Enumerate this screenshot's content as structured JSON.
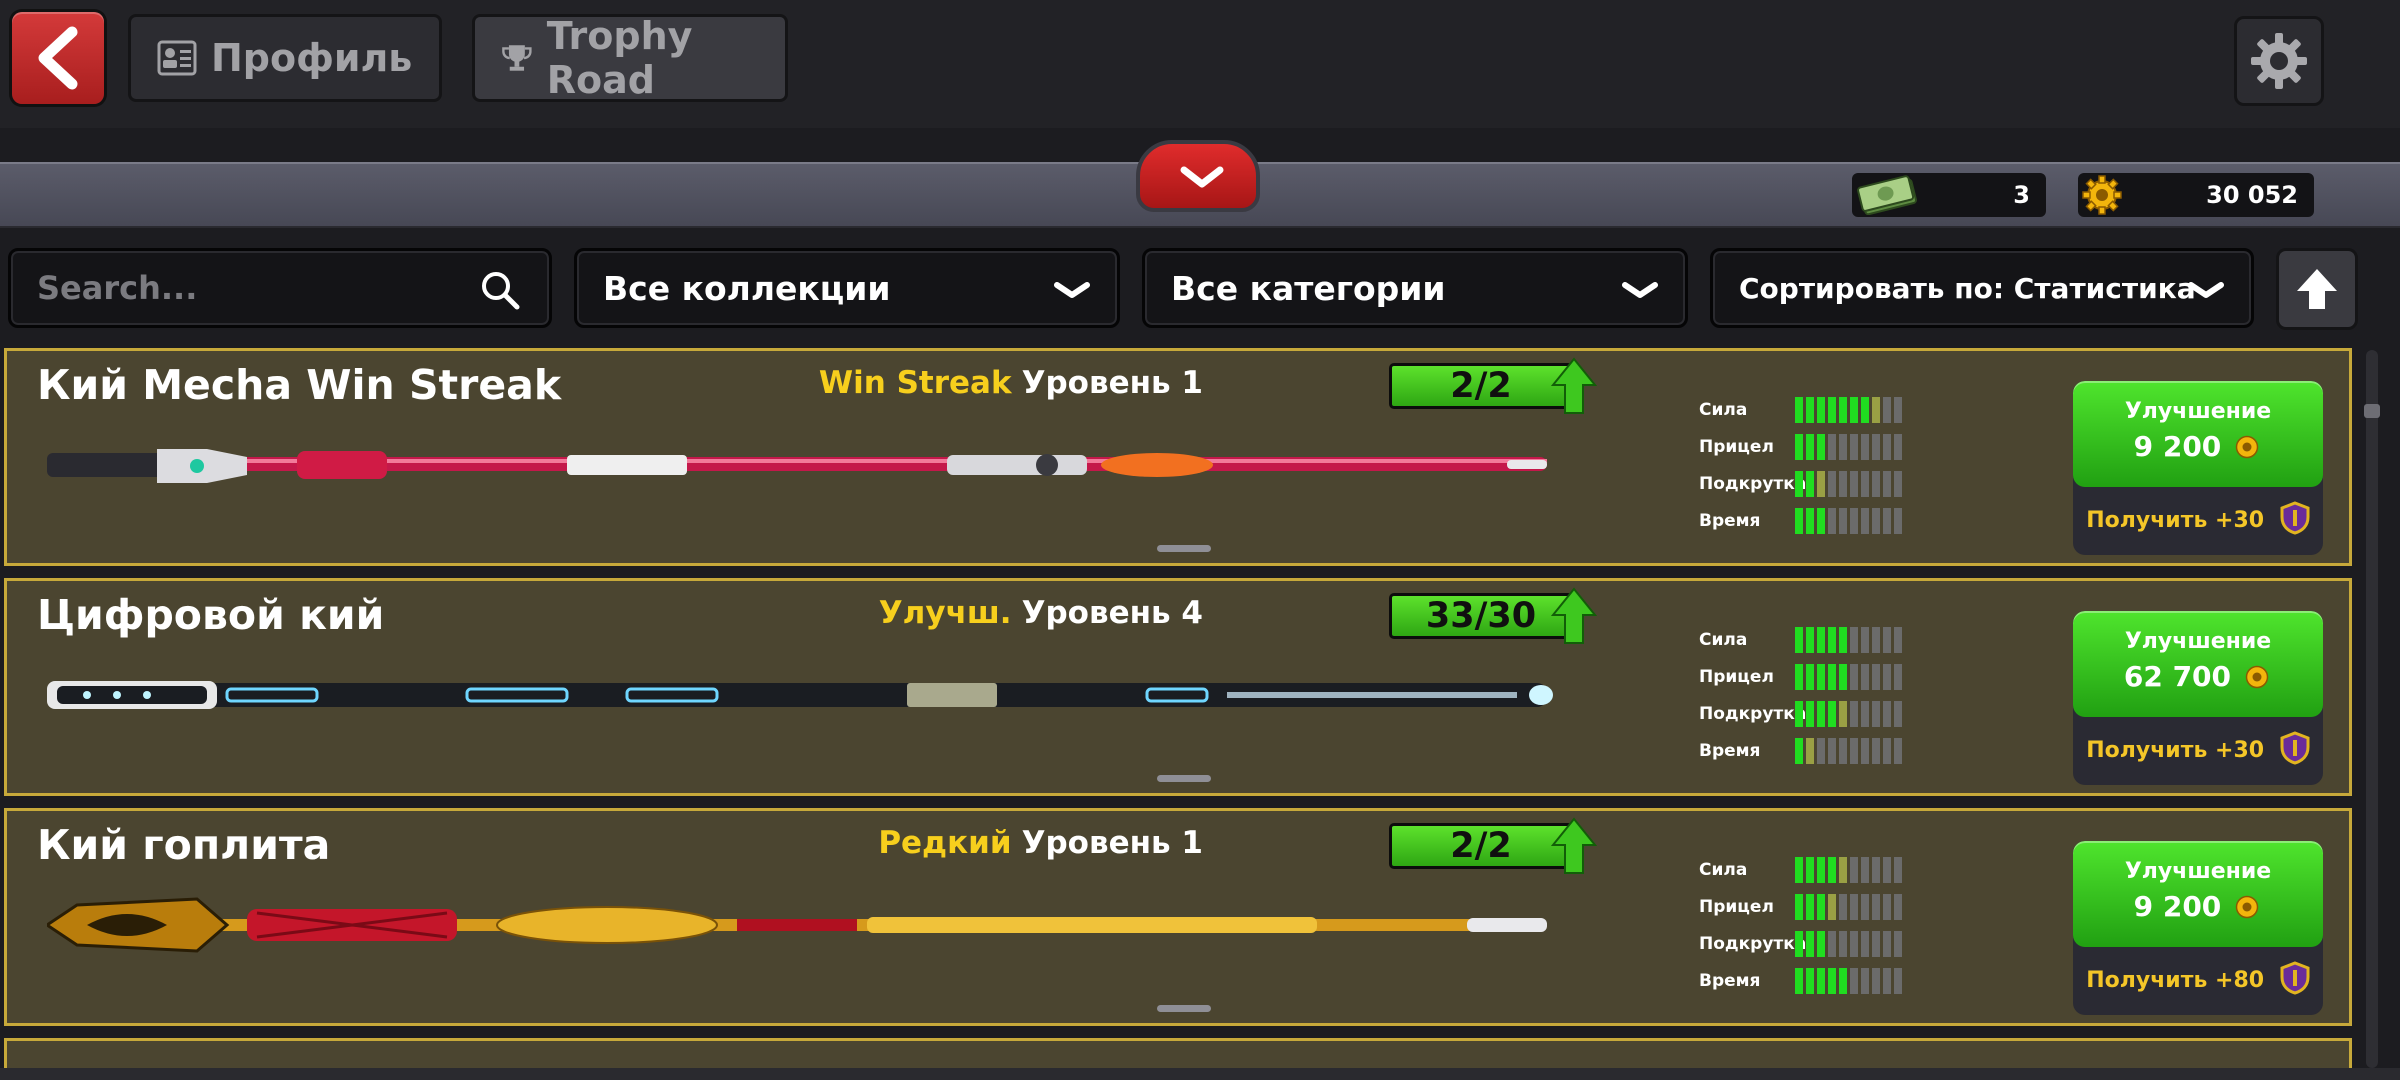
{
  "header": {
    "tabs": [
      {
        "label": "Профиль",
        "icon": "profile-card-icon",
        "active": false
      },
      {
        "label": "Trophy Road",
        "icon": "trophy-icon",
        "active": true
      }
    ]
  },
  "currencies": {
    "cash": "3",
    "coins": "30 052"
  },
  "filters": {
    "search_placeholder": "Search...",
    "collection": "Все коллекции",
    "category": "Все категории",
    "sort": "Сортировать по: Статистика"
  },
  "stat_labels": [
    "Сила",
    "Прицел",
    "Подкрутка",
    "Время"
  ],
  "cues": [
    {
      "name": "Кий Mecha Win Streak",
      "rarity": "Win Streak",
      "level": "Уровень 1",
      "pieces": "2/2",
      "stats": [
        7,
        3,
        2,
        3
      ],
      "stats_partial": [
        1,
        0,
        1,
        0
      ],
      "upgrade_label": "Улучшение",
      "upgrade_price": "9 200",
      "reward": "Получить +30"
    },
    {
      "name": "Цифровой кий",
      "rarity": "Улучш.",
      "level": "Уровень 4",
      "pieces": "33/30",
      "stats": [
        5,
        5,
        4,
        1
      ],
      "stats_partial": [
        0,
        0,
        1,
        1
      ],
      "upgrade_label": "Улучшение",
      "upgrade_price": "62 700",
      "reward": "Получить +30"
    },
    {
      "name": "Кий гоплита",
      "rarity": "Редкий",
      "level": "Уровень 1",
      "pieces": "2/2",
      "stats": [
        4,
        3,
        3,
        5
      ],
      "stats_partial": [
        1,
        1,
        0,
        0
      ],
      "upgrade_label": "Улучшение",
      "upgrade_price": "9 200",
      "reward": "Получить +80"
    }
  ],
  "colors": {
    "card_bg": "#4b4530",
    "card_border": "#c7a93a",
    "upgrade_green": "#3cc41f",
    "rarity_yellow": "#f7cf1d",
    "back_red": "#c62828"
  }
}
